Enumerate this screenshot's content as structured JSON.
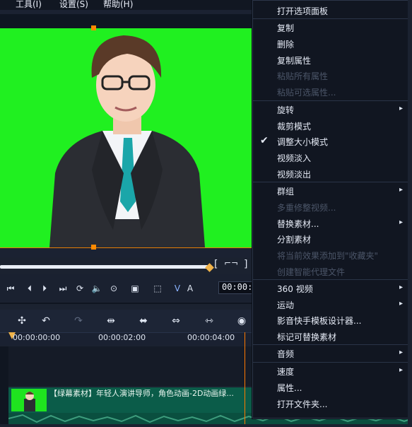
{
  "menubar": {
    "items": [
      "工具(I)",
      "设置(S)",
      "帮助(H)"
    ]
  },
  "preview": {
    "bracket_left": "[",
    "bracket_right": "]",
    "timecode": "00:00:0"
  },
  "transport": {
    "labels": [
      "V",
      "A"
    ]
  },
  "timeline": {
    "ruler_labels": [
      "00:00:00:00",
      "00:00:02:00",
      "00:00:04:00"
    ],
    "clip_title": "【绿幕素材】年轻人演讲导师，角色动画-2D动画绿..."
  },
  "context_menu": {
    "items": [
      {
        "label": "打开选项面板",
        "enabled": true,
        "checked": false,
        "submenu": false
      },
      {
        "label": "复制",
        "enabled": true,
        "checked": false,
        "submenu": false
      },
      {
        "label": "删除",
        "enabled": true,
        "checked": false,
        "submenu": false
      },
      {
        "label": "复制属性",
        "enabled": true,
        "checked": false,
        "submenu": false
      },
      {
        "label": "粘贴所有属性",
        "enabled": false,
        "checked": false,
        "submenu": false
      },
      {
        "label": "粘贴可选属性...",
        "enabled": false,
        "checked": false,
        "submenu": false
      },
      {
        "label": "旋转",
        "enabled": true,
        "checked": false,
        "submenu": true
      },
      {
        "label": "裁剪模式",
        "enabled": true,
        "checked": false,
        "submenu": false
      },
      {
        "label": "调整大小模式",
        "enabled": true,
        "checked": true,
        "submenu": false
      },
      {
        "label": "视频淡入",
        "enabled": true,
        "checked": false,
        "submenu": false
      },
      {
        "label": "视频淡出",
        "enabled": true,
        "checked": false,
        "submenu": false
      },
      {
        "label": "群组",
        "enabled": true,
        "checked": false,
        "submenu": true
      },
      {
        "label": "多重修整视频...",
        "enabled": false,
        "checked": false,
        "submenu": false
      },
      {
        "label": "替换素材...",
        "enabled": true,
        "checked": false,
        "submenu": true
      },
      {
        "label": "分割素材",
        "enabled": true,
        "checked": false,
        "submenu": false
      },
      {
        "label": "将当前效果添加到\"收藏夹\"",
        "enabled": false,
        "checked": false,
        "submenu": false
      },
      {
        "label": "创建智能代理文件",
        "enabled": false,
        "checked": false,
        "submenu": false
      },
      {
        "label": "360 视频",
        "enabled": true,
        "checked": false,
        "submenu": true
      },
      {
        "label": "运动",
        "enabled": true,
        "checked": false,
        "submenu": true
      },
      {
        "label": "影音快手模板设计器...",
        "enabled": true,
        "checked": false,
        "submenu": false
      },
      {
        "label": "标记可替换素材",
        "enabled": true,
        "checked": false,
        "submenu": false
      },
      {
        "label": "音频",
        "enabled": true,
        "checked": false,
        "submenu": true
      },
      {
        "label": "速度",
        "enabled": true,
        "checked": false,
        "submenu": true
      },
      {
        "label": "属性...",
        "enabled": true,
        "checked": false,
        "submenu": false
      },
      {
        "label": "打开文件夹...",
        "enabled": true,
        "checked": false,
        "submenu": false
      }
    ]
  },
  "icons": {
    "submenu_arrow": "▸",
    "check": "✔"
  }
}
